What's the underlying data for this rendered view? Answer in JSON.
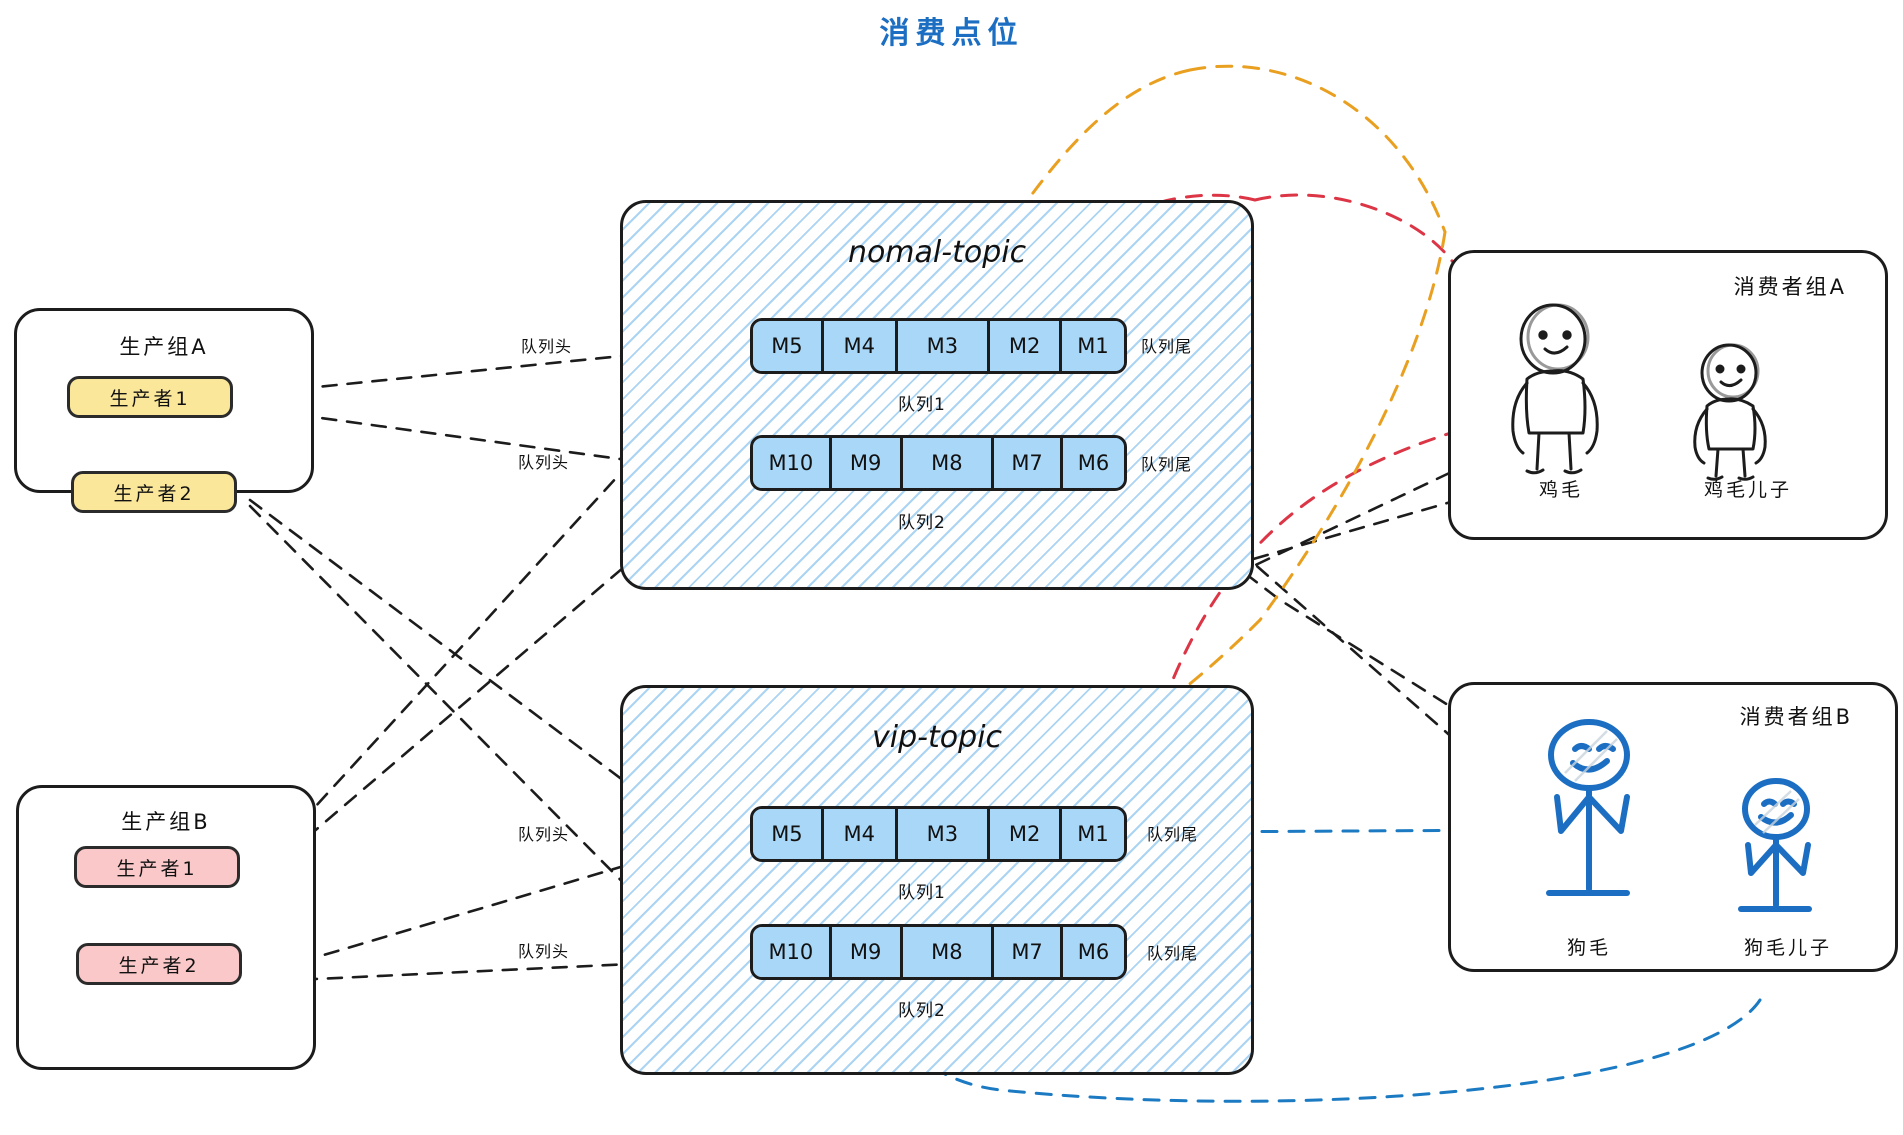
{
  "page": {
    "title": "消费点位",
    "title_color": "#1b6ec2",
    "background": "#ffffff"
  },
  "colors": {
    "producer_a_fill": "#fbe79a",
    "producer_b_fill": "#fac8c8",
    "message_fill": "#a9d7f8",
    "topic_hatch": "#78b9eb",
    "stroke": "#1c1c1c",
    "consumer_b_ink": "#1b6ec2",
    "wire_black": "#1c1c1c",
    "wire_red": "#dc3545",
    "wire_orange": "#e9a020",
    "wire_blue": "#1b7ac2"
  },
  "producer_groups": [
    {
      "id": "group-a",
      "label": "生产组A",
      "fill": "#fbe79a",
      "producers": [
        {
          "label": "生产者1"
        },
        {
          "label": "生产者2"
        }
      ]
    },
    {
      "id": "group-b",
      "label": "生产组B",
      "fill": "#fac8c8",
      "producers": [
        {
          "label": "生产者1"
        },
        {
          "label": "生产者2"
        }
      ]
    }
  ],
  "topics": [
    {
      "id": "nomal-topic",
      "name": "nomal-topic",
      "queues": [
        {
          "caption": "队列1",
          "head_label": "队列头",
          "tail_label": "队列尾",
          "messages": [
            "M5",
            "M4",
            "M3",
            "M2",
            "M1"
          ]
        },
        {
          "caption": "队列2",
          "head_label": "队列头",
          "tail_label": "队列尾",
          "messages": [
            "M10",
            "M9",
            "M8",
            "M7",
            "M6"
          ]
        }
      ]
    },
    {
      "id": "vip-topic",
      "name": "vip-topic",
      "queues": [
        {
          "caption": "队列1",
          "head_label": "队列头",
          "tail_label": "队列尾",
          "messages": [
            "M5",
            "M4",
            "M3",
            "M2",
            "M1"
          ]
        },
        {
          "caption": "队列2",
          "head_label": "队列头",
          "tail_label": "队列尾",
          "messages": [
            "M10",
            "M9",
            "M8",
            "M7",
            "M6"
          ]
        }
      ]
    }
  ],
  "consumer_groups": [
    {
      "id": "consumer-group-a",
      "label": "消费者组A",
      "ink": "#1c1c1c",
      "consumers": [
        {
          "name": "鸡毛",
          "style": "big"
        },
        {
          "name": "鸡毛儿子",
          "style": "small"
        }
      ]
    },
    {
      "id": "consumer-group-b",
      "label": "消费者组B",
      "ink": "#1b6ec2",
      "consumers": [
        {
          "name": "狗毛",
          "style": "big"
        },
        {
          "name": "狗毛儿子",
          "style": "small"
        }
      ]
    }
  ]
}
